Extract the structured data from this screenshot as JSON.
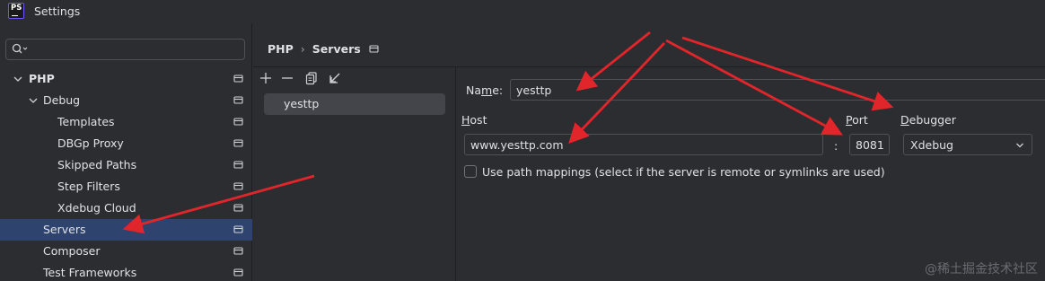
{
  "window": {
    "app_icon_text": "PS",
    "title": "Settings"
  },
  "sidebar": {
    "search_placeholder": "",
    "tree": [
      {
        "label": "PHP",
        "bold": true,
        "expanded": true,
        "selected": false
      },
      {
        "label": "Debug",
        "bold": false,
        "expanded": true,
        "selected": false
      },
      {
        "label": "Templates",
        "bold": false,
        "selected": false
      },
      {
        "label": "DBGp Proxy",
        "bold": false,
        "selected": false
      },
      {
        "label": "Skipped Paths",
        "bold": false,
        "selected": false
      },
      {
        "label": "Step Filters",
        "bold": false,
        "selected": false
      },
      {
        "label": "Xdebug Cloud",
        "bold": false,
        "selected": false
      },
      {
        "label": "Servers",
        "bold": false,
        "selected": true
      },
      {
        "label": "Composer",
        "bold": false,
        "selected": false
      },
      {
        "label": "Test Frameworks",
        "bold": false,
        "selected": false
      }
    ]
  },
  "breadcrumb": {
    "parent": "PHP",
    "separator": "›",
    "current": "Servers"
  },
  "servers_list": {
    "items": [
      "yesttp"
    ]
  },
  "form": {
    "name_label_prefix": "Na",
    "name_label_mnemonic": "m",
    "name_label_suffix": "e:",
    "name_value": "yesttp",
    "host_label_mnemonic": "H",
    "host_label_suffix": "ost",
    "host_value": "www.yesttp.com",
    "port_separator": ":",
    "port_label_mnemonic": "P",
    "port_label_suffix": "ort",
    "port_value": "8081",
    "debugger_label_mnemonic": "D",
    "debugger_label_suffix": "ebugger",
    "debugger_value": "Xdebug",
    "path_mappings_label": "Use path mappings (select if the server is remote or symlinks are used)",
    "path_mappings_checked": false
  },
  "watermark": "@稀土掘金技术社区",
  "colors": {
    "selection": "#2e436e",
    "annotation_arrow": "#e0262b",
    "background": "#2b2d30"
  }
}
